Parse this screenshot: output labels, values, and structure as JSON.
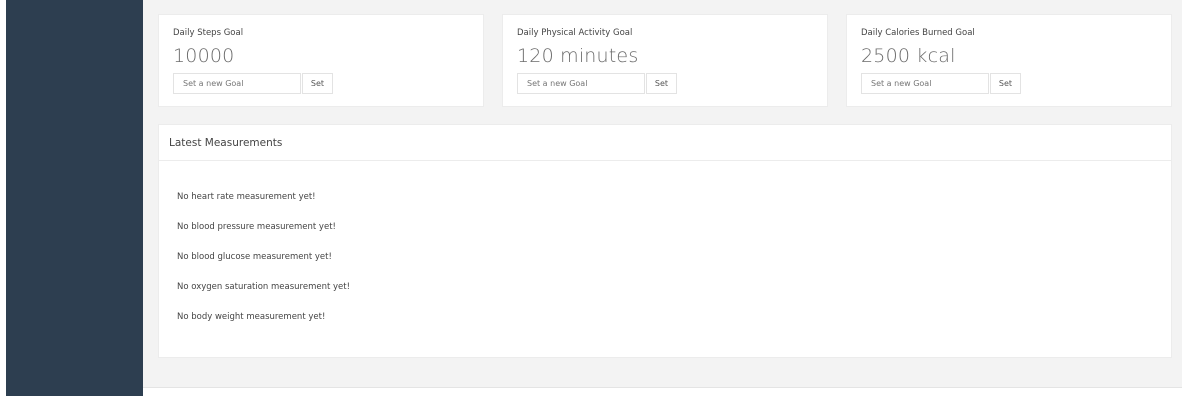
{
  "goals": [
    {
      "title": "Daily Steps Goal",
      "value": "10000",
      "placeholder": "Set a new Goal",
      "button": "Set"
    },
    {
      "title": "Daily Physical Activity Goal",
      "value": "120 minutes",
      "placeholder": "Set a new Goal",
      "button": "Set"
    },
    {
      "title": "Daily Calories Burned Goal",
      "value": "2500 kcal",
      "placeholder": "Set a new Goal",
      "button": "Set"
    }
  ],
  "measurements": {
    "title": "Latest Measurements",
    "items": [
      "No heart rate measurement yet!",
      "No blood pressure measurement yet!",
      "No blood glucose measurement yet!",
      "No oxygen saturation measurement yet!",
      "No body weight measurement yet!"
    ]
  },
  "colors": {
    "sidebar": "#2d3e50",
    "content_bg": "#f3f3f3",
    "card_bg": "#ffffff"
  }
}
